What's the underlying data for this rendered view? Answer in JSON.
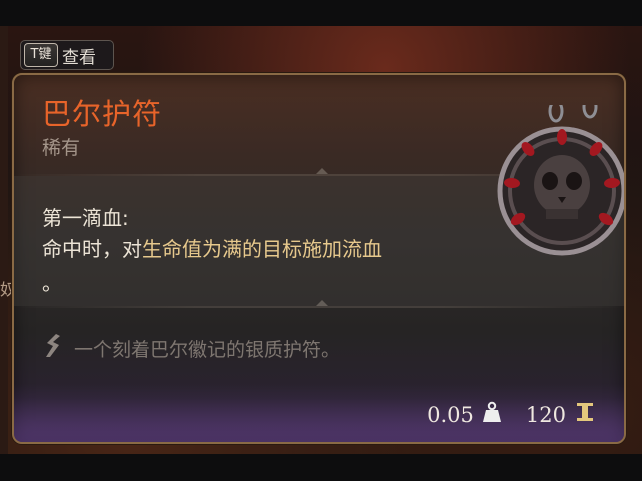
{
  "hint": {
    "key": "T键",
    "label": "查看"
  },
  "background": {
    "edge_text": "奴"
  },
  "tooltip": {
    "name": "巴尔护符",
    "rarity": "稀有",
    "passive": {
      "title": "第一滴血:",
      "desc_prefix": "命中时，对",
      "desc_highlight": "生命值为满的目标施加流血",
      "desc_suffix": "。"
    },
    "flavor": "一个刻着巴尔徽记的银质护符。",
    "weight": "0.05",
    "price": "120"
  },
  "icons": {
    "weight": "weight-icon",
    "price": "gold-coin-icon",
    "flavor": "feather-quill-icon",
    "item": "skull-amulet-icon"
  },
  "colors": {
    "name": "#e8642a",
    "rarity": "#a4958a",
    "highlight": "#e7c98d",
    "border": "#8a6a45"
  }
}
